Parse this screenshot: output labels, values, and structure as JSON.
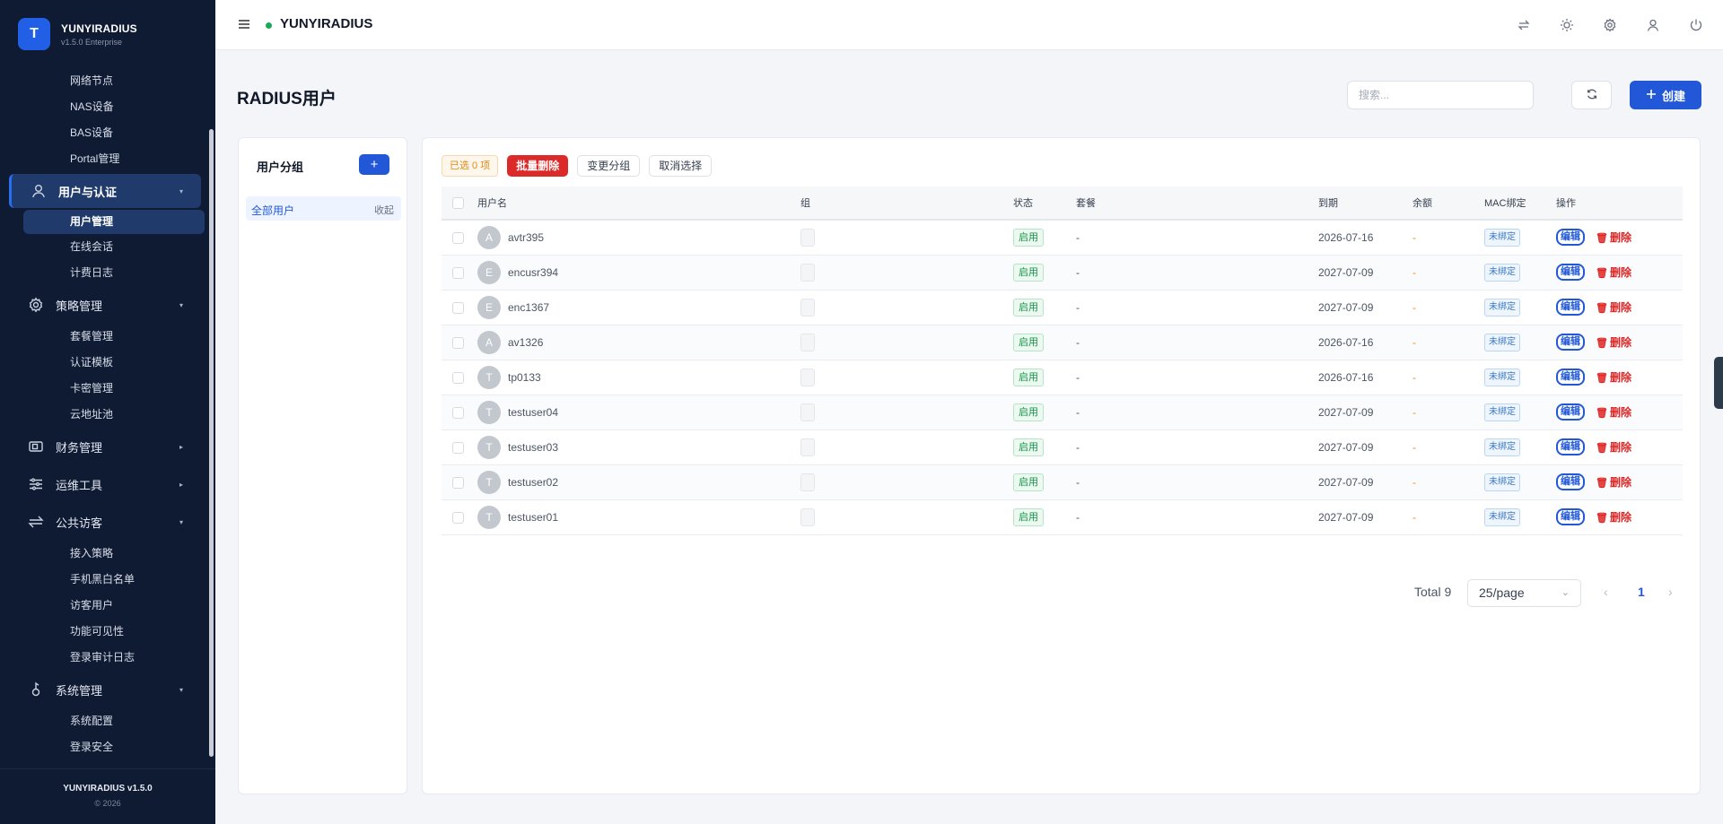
{
  "brand": {
    "logo_letter": "T",
    "name": "YUNYIRADIUS",
    "version": "v1.5.0 Enterprise"
  },
  "sidebar": {
    "items": [
      {
        "type": "sub",
        "label": "网络节点"
      },
      {
        "type": "sub",
        "label": "NAS设备"
      },
      {
        "type": "sub",
        "label": "BAS设备"
      },
      {
        "type": "sub",
        "label": "Portal管理"
      },
      {
        "type": "group",
        "label": "用户与认证",
        "icon": "user-icon",
        "active": true,
        "arrow": "▾"
      },
      {
        "type": "sub",
        "label": "用户管理",
        "active": true
      },
      {
        "type": "sub",
        "label": "在线会话"
      },
      {
        "type": "sub",
        "label": "计费日志"
      },
      {
        "type": "group",
        "label": "策略管理",
        "icon": "gear-icon",
        "arrow": "▾"
      },
      {
        "type": "sub",
        "label": "套餐管理"
      },
      {
        "type": "sub",
        "label": "认证模板"
      },
      {
        "type": "sub",
        "label": "卡密管理"
      },
      {
        "type": "sub",
        "label": "云地址池"
      },
      {
        "type": "group",
        "label": "财务管理",
        "icon": "wallet-icon",
        "arrow": "▸"
      },
      {
        "type": "group",
        "label": "运维工具",
        "icon": "sliders-icon",
        "arrow": "▸"
      },
      {
        "type": "group",
        "label": "公共访客",
        "icon": "swap-icon",
        "arrow": "▾"
      },
      {
        "type": "sub",
        "label": "接入策略"
      },
      {
        "type": "sub",
        "label": "手机黑白名单"
      },
      {
        "type": "sub",
        "label": "访客用户"
      },
      {
        "type": "sub",
        "label": "功能可见性"
      },
      {
        "type": "sub",
        "label": "登录审计日志"
      },
      {
        "type": "group",
        "label": "系统管理",
        "icon": "key-icon",
        "arrow": "▾"
      },
      {
        "type": "sub",
        "label": "系统配置"
      },
      {
        "type": "sub",
        "label": "登录安全"
      }
    ],
    "footer": {
      "product": "YUNYIRADIUS v1.5.0",
      "copyright": "© 2026"
    }
  },
  "topbar": {
    "title": "YUNYIRADIUS",
    "icons": [
      "swap-icon",
      "sun-icon",
      "gear-icon",
      "user-icon",
      "power-icon"
    ]
  },
  "page": {
    "title": "RADIUS用户",
    "search_placeholder": "搜索...",
    "create_label": "创建"
  },
  "groups_panel": {
    "title": "用户分组",
    "add_label": "+",
    "all_users": "全部用户",
    "collapse": "收起"
  },
  "bulk": {
    "selected": "已选 0 项",
    "batch_delete": "批量删除",
    "change_group": "变更分组",
    "cancel_select": "取消选择"
  },
  "table": {
    "headers": [
      "用户名",
      "组",
      "状态",
      "套餐",
      "到期",
      "余额",
      "MAC绑定",
      "操作"
    ],
    "edit_label": "编辑",
    "delete_label": "删除",
    "rows": [
      {
        "initial": "A",
        "username": "avtr395",
        "status": "启用",
        "plan": "-",
        "expire": "2026-07-16",
        "balance": "-",
        "mac": "未绑定"
      },
      {
        "initial": "E",
        "username": "encusr394",
        "status": "启用",
        "plan": "-",
        "expire": "2027-07-09",
        "balance": "-",
        "mac": "未绑定"
      },
      {
        "initial": "E",
        "username": "enc1367",
        "status": "启用",
        "plan": "-",
        "expire": "2027-07-09",
        "balance": "-",
        "mac": "未绑定"
      },
      {
        "initial": "A",
        "username": "av1326",
        "status": "启用",
        "plan": "-",
        "expire": "2026-07-16",
        "balance": "-",
        "mac": "未绑定"
      },
      {
        "initial": "T",
        "username": "tp0133",
        "status": "启用",
        "plan": "-",
        "expire": "2026-07-16",
        "balance": "-",
        "mac": "未绑定"
      },
      {
        "initial": "T",
        "username": "testuser04",
        "status": "启用",
        "plan": "-",
        "expire": "2027-07-09",
        "balance": "-",
        "mac": "未绑定"
      },
      {
        "initial": "T",
        "username": "testuser03",
        "status": "启用",
        "plan": "-",
        "expire": "2027-07-09",
        "balance": "-",
        "mac": "未绑定"
      },
      {
        "initial": "T",
        "username": "testuser02",
        "status": "启用",
        "plan": "-",
        "expire": "2027-07-09",
        "balance": "-",
        "mac": "未绑定"
      },
      {
        "initial": "T",
        "username": "testuser01",
        "status": "启用",
        "plan": "-",
        "expire": "2027-07-09",
        "balance": "-",
        "mac": "未绑定"
      }
    ]
  },
  "pagination": {
    "total": "Total 9",
    "page_size": "25/page",
    "current": "1"
  },
  "colors": {
    "sidebar_bg": "#0f1b33",
    "accent": "#2258d8",
    "danger": "#dc2a2a",
    "success": "#159447",
    "warning": "#f08a1a"
  }
}
